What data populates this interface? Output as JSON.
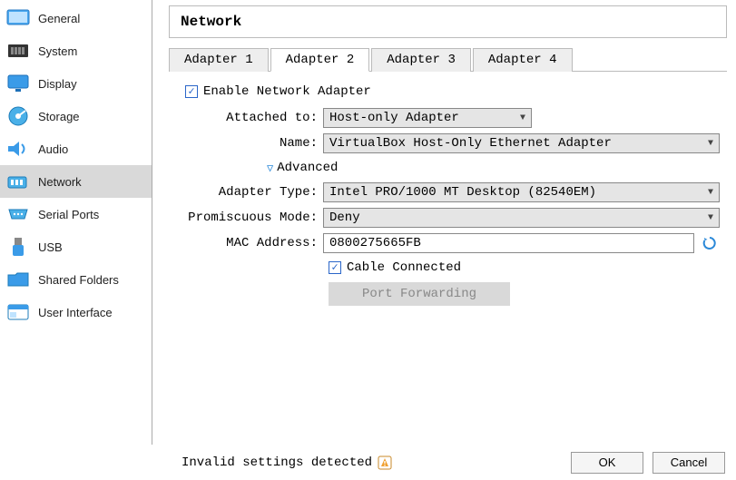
{
  "sidebar": {
    "items": [
      {
        "label": "General"
      },
      {
        "label": "System"
      },
      {
        "label": "Display"
      },
      {
        "label": "Storage"
      },
      {
        "label": "Audio"
      },
      {
        "label": "Network"
      },
      {
        "label": "Serial Ports"
      },
      {
        "label": "USB"
      },
      {
        "label": "Shared Folders"
      },
      {
        "label": "User Interface"
      }
    ],
    "selected_index": 5
  },
  "header": {
    "title": "Network"
  },
  "tabs": [
    {
      "label": "Adapter 1"
    },
    {
      "label": "Adapter 2"
    },
    {
      "label": "Adapter 3"
    },
    {
      "label": "Adapter 4"
    }
  ],
  "active_tab_index": 1,
  "form": {
    "enable_label": "Enable Network Adapter",
    "enable_checked": true,
    "attached_label": "Attached to:",
    "attached_value": "Host-only Adapter",
    "name_label": "Name:",
    "name_value": "VirtualBox Host-Only Ethernet Adapter",
    "advanced_label": "Advanced",
    "adapter_type_label": "Adapter Type:",
    "adapter_type_value": "Intel PRO/1000 MT Desktop (82540EM)",
    "promisc_label": "Promiscuous Mode:",
    "promisc_value": "Deny",
    "mac_label": "MAC Address:",
    "mac_value": "0800275665FB",
    "cable_label": "Cable Connected",
    "cable_checked": true,
    "port_fwd_label": "Port Forwarding"
  },
  "footer": {
    "status": "Invalid settings detected",
    "ok": "OK",
    "cancel": "Cancel"
  }
}
